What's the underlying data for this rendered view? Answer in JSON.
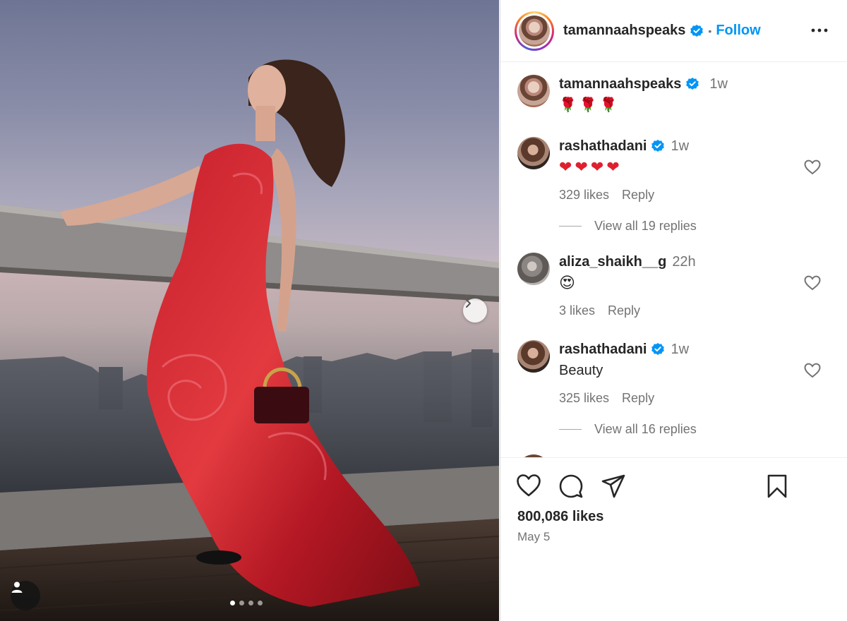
{
  "post": {
    "author": "tamannaahspeaks",
    "follow_label": "Follow",
    "separator": "•",
    "caption": {
      "username": "tamannaahspeaks",
      "time": "1w",
      "emoji": [
        "🌹",
        "🌹",
        "🌹"
      ]
    },
    "likes": "800,086 likes",
    "date": "May 5",
    "carousel": {
      "total_slides": 4,
      "active_slide": 1
    }
  },
  "comments": [
    {
      "username": "rashathadani",
      "verified": true,
      "time": "1w",
      "emoji": [
        "❤",
        "❤",
        "❤",
        "❤"
      ],
      "likes": "329 likes",
      "reply_label": "Reply",
      "view_replies": "View all 19 replies"
    },
    {
      "username": "aliza_shaikh__g",
      "verified": false,
      "time": "22h",
      "emoji": [
        "😍"
      ],
      "likes": "3 likes",
      "reply_label": "Reply"
    },
    {
      "username": "rashathadani",
      "verified": true,
      "time": "1w",
      "text": "Beauty",
      "likes": "325 likes",
      "reply_label": "Reply",
      "view_replies": "View all 16 replies"
    }
  ],
  "colors": {
    "link_blue": "#0095f6",
    "verified_blue": "#0095f6",
    "text": "#262626",
    "secondary_text": "#737373",
    "heart_red": "#e0202e"
  },
  "icons": [
    "carousel-next-icon",
    "user-tag-icon",
    "verified-icon",
    "more-icon",
    "heart-icon",
    "comment-icon",
    "share-icon",
    "bookmark-icon"
  ]
}
